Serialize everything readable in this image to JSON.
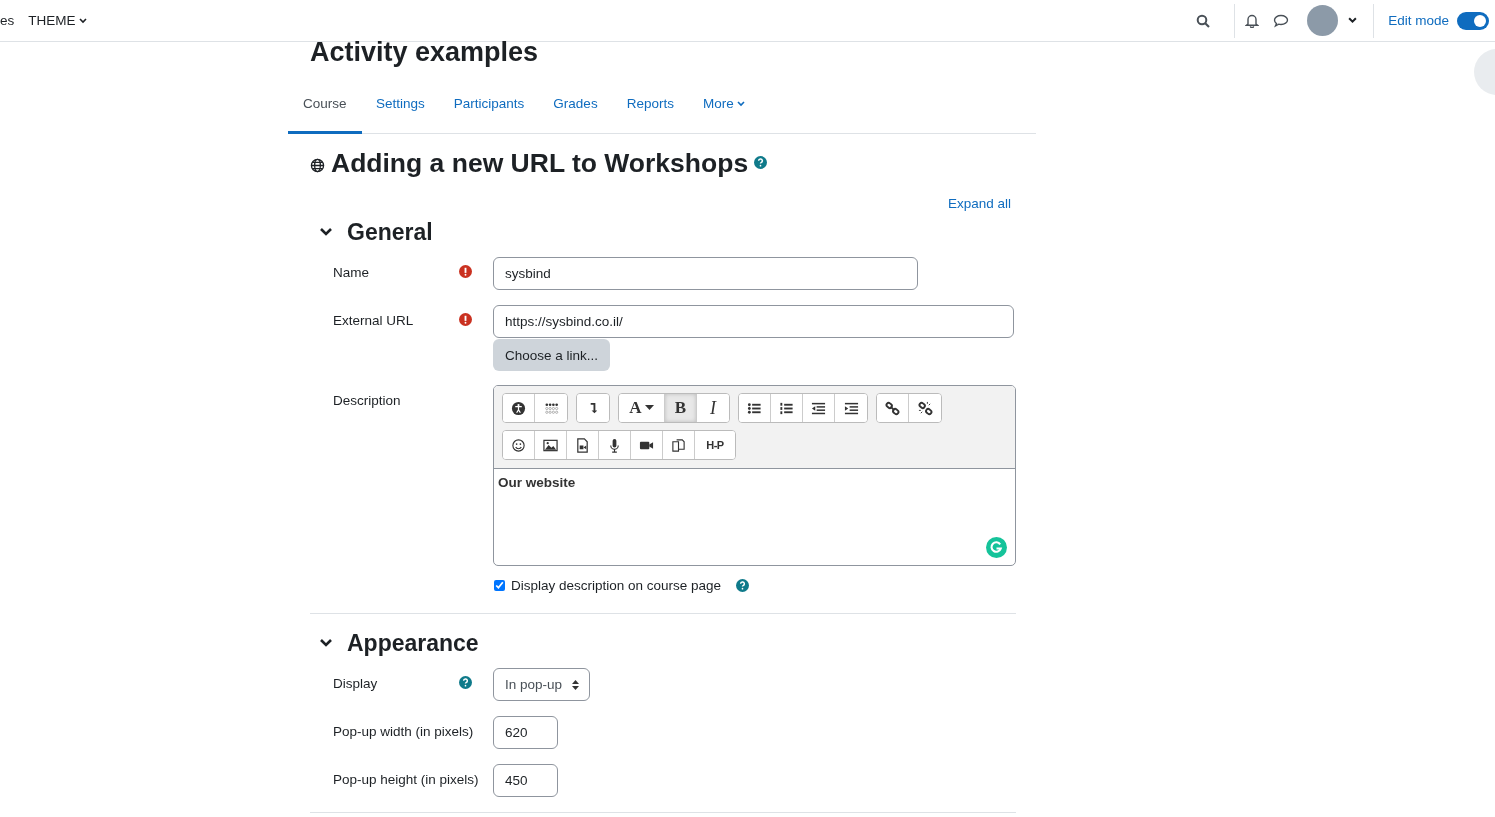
{
  "navbar": {
    "items": [
      {
        "label": "es",
        "dropdown": false
      },
      {
        "label": "THEME",
        "dropdown": true
      }
    ],
    "edit_mode": {
      "label": "Edit mode",
      "on": true
    }
  },
  "course": {
    "title": "Activity examples"
  },
  "tabs": [
    {
      "label": "Course",
      "selected": true,
      "dropdown": false
    },
    {
      "label": "Settings",
      "selected": false,
      "dropdown": false
    },
    {
      "label": "Participants",
      "selected": false,
      "dropdown": false
    },
    {
      "label": "Grades",
      "selected": false,
      "dropdown": false
    },
    {
      "label": "Reports",
      "selected": false,
      "dropdown": false
    },
    {
      "label": "More",
      "selected": false,
      "dropdown": true
    }
  ],
  "heading": {
    "text": "Adding a new URL to Workshops",
    "help": true
  },
  "expand_all": "Expand all",
  "sections": [
    {
      "title": "General",
      "expanded": true,
      "fields": [
        {
          "kind": "text",
          "label": "Name",
          "required": true,
          "help": false,
          "value": "sysbind"
        },
        {
          "kind": "url",
          "label": "External URL",
          "required": true,
          "help": false,
          "value": "https://sysbind.co.il/",
          "button": "Choose a link..."
        },
        {
          "kind": "editor",
          "label": "Description",
          "required": false,
          "help": false,
          "content": "Our website",
          "toolbar": [
            [
              [
                {
                  "kind": "accessibility",
                  "pressed": false
                },
                {
                  "kind": "braille",
                  "pressed": false
                }
              ],
              [
                {
                  "kind": "collapse",
                  "pressed": false
                }
              ],
              [
                {
                  "kind": "text-color",
                  "label": "A",
                  "pressed": false
                },
                {
                  "kind": "bold",
                  "label": "B",
                  "pressed": true
                },
                {
                  "kind": "italic",
                  "label": "I",
                  "pressed": false
                }
              ],
              [
                {
                  "kind": "bullet-list",
                  "pressed": false
                },
                {
                  "kind": "numbered-list",
                  "pressed": false
                },
                {
                  "kind": "outdent",
                  "pressed": false
                },
                {
                  "kind": "indent",
                  "pressed": false
                }
              ],
              [
                {
                  "kind": "link",
                  "pressed": false
                },
                {
                  "kind": "unlink",
                  "pressed": false
                }
              ]
            ],
            [
              [
                {
                  "kind": "emoji",
                  "pressed": false
                },
                {
                  "kind": "image",
                  "pressed": false
                },
                {
                  "kind": "media",
                  "pressed": false
                },
                {
                  "kind": "microphone",
                  "pressed": false
                },
                {
                  "kind": "video",
                  "pressed": false
                },
                {
                  "kind": "copy",
                  "pressed": false
                },
                {
                  "kind": "h5p",
                  "label": "H-P",
                  "pressed": false
                }
              ]
            ]
          ]
        },
        {
          "kind": "checkbox",
          "label": "Display description on course page",
          "required": false,
          "help": true,
          "checked": true
        }
      ]
    },
    {
      "title": "Appearance",
      "expanded": true,
      "fields": [
        {
          "kind": "select",
          "label": "Display",
          "required": false,
          "help": true,
          "value": "In pop-up"
        },
        {
          "kind": "number",
          "label": "Pop-up width (in pixels)",
          "required": false,
          "help": false,
          "value": "620"
        },
        {
          "kind": "number",
          "label": "Pop-up height (in pixels)",
          "required": false,
          "help": false,
          "value": "450"
        }
      ]
    }
  ]
}
